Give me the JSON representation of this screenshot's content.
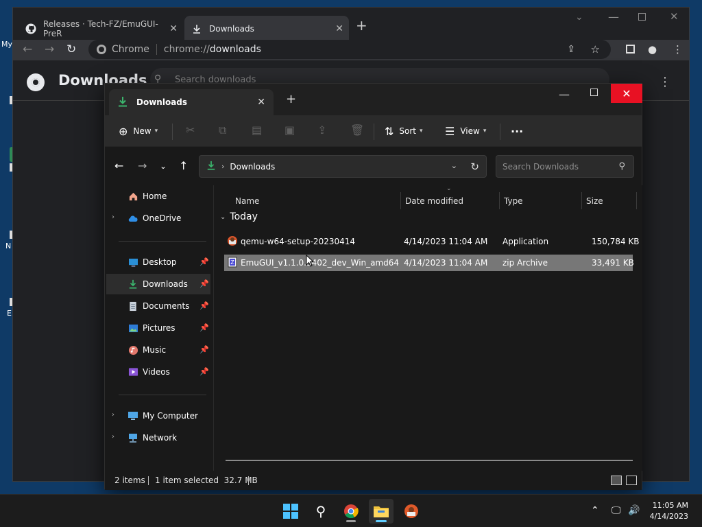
{
  "desktop": {
    "icon_labels": [
      "My",
      "N",
      "E"
    ]
  },
  "chrome": {
    "tabs": [
      {
        "label": "Releases · Tech-FZ/EmuGUI-PreR",
        "icon": "github-icon"
      },
      {
        "label": "Downloads",
        "icon": "download-icon"
      }
    ],
    "omnibox": {
      "site_label": "Chrome",
      "url_prefix": "chrome://",
      "url_path": "downloads"
    },
    "page_title": "Downloads",
    "search_placeholder": "Search downloads"
  },
  "explorer": {
    "tab_label": "Downloads",
    "commands": {
      "new": "New",
      "sort": "Sort",
      "view": "View",
      "more": "···"
    },
    "address_crumb": "Downloads",
    "search_placeholder": "Search Downloads",
    "nav": {
      "home": "Home",
      "onedrive": "OneDrive",
      "desktop": "Desktop",
      "downloads": "Downloads",
      "documents": "Documents",
      "pictures": "Pictures",
      "music": "Music",
      "videos": "Videos",
      "my_computer": "My Computer",
      "network": "Network"
    },
    "columns": {
      "name": "Name",
      "date": "Date modified",
      "type": "Type",
      "size": "Size"
    },
    "group_label": "Today",
    "files": [
      {
        "name": "qemu-w64-setup-20230414",
        "date": "4/14/2023 11:04 AM",
        "type": "Application",
        "size": "150,784 KB",
        "selected": false
      },
      {
        "name": "EmuGUI_v1.1.0.5402_dev_Win_amd64",
        "date": "4/14/2023 11:04 AM",
        "type": "zip Archive",
        "size": "33,491 KB",
        "selected": true
      }
    ],
    "status": {
      "items": "2 items",
      "selected": "1 item selected  32.7 MB"
    }
  },
  "taskbar": {
    "time": "11:05 AM",
    "date": "4/14/2023"
  },
  "colors": {
    "accent": "#60cdff",
    "close_red": "#e81123",
    "selected_row": "#777777"
  }
}
